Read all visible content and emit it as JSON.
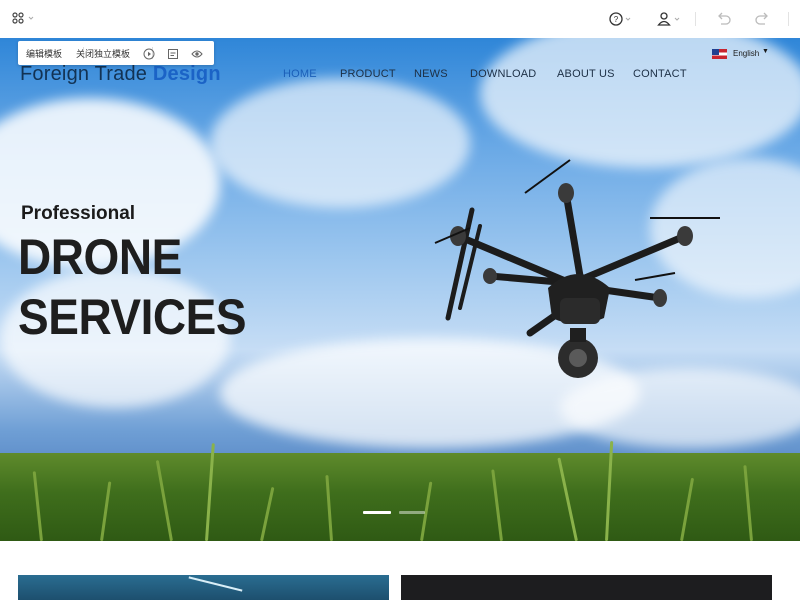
{
  "toolbar": {
    "apps_icon": "grid-apps-icon",
    "help_icon": "question-circle-icon",
    "user_icon": "user-icon",
    "undo_icon": "undo-icon",
    "redo_icon": "redo-icon"
  },
  "edit_popup": {
    "edit_label": "编辑模板",
    "close_label": "关闭独立模板",
    "icons": [
      "play-icon",
      "layout-icon",
      "preview-eye-icon"
    ]
  },
  "site": {
    "logo_text": "Foreign Trade",
    "logo_accent": "Design",
    "nav": [
      {
        "label": "HOME",
        "active": true
      },
      {
        "label": "PRODUCT",
        "active": false
      },
      {
        "label": "NEWS",
        "active": false
      },
      {
        "label": "DOWNLOAD",
        "active": false
      },
      {
        "label": "ABOUT US",
        "active": false
      },
      {
        "label": "CONTACT",
        "active": false
      }
    ],
    "language": "English"
  },
  "hero": {
    "kicker": "Professional",
    "headline_1": "DRONE",
    "headline_2": "SERVICES",
    "slides": 2,
    "active_slide": 1
  },
  "colors": {
    "brand": "#1b63c6",
    "nav_active": "#1b5fb8",
    "text_dark": "#1e1e1e"
  }
}
